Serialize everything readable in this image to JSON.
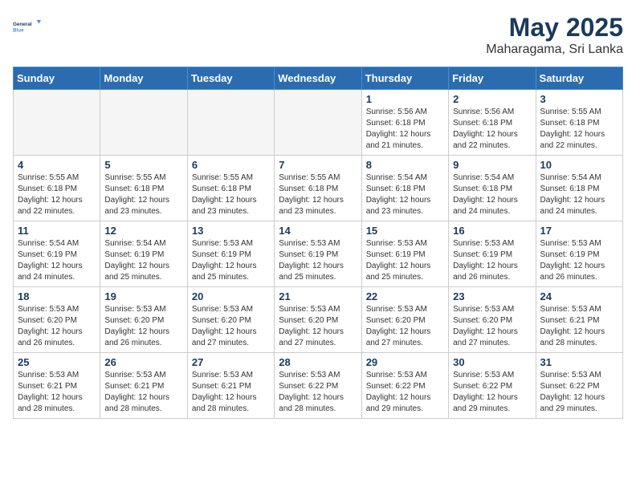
{
  "logo": {
    "name": "General",
    "accent": "Blue"
  },
  "title": "May 2025",
  "subtitle": "Maharagama, Sri Lanka",
  "weekdays": [
    "Sunday",
    "Monday",
    "Tuesday",
    "Wednesday",
    "Thursday",
    "Friday",
    "Saturday"
  ],
  "weeks": [
    [
      {
        "day": "",
        "empty": true
      },
      {
        "day": "",
        "empty": true
      },
      {
        "day": "",
        "empty": true
      },
      {
        "day": "",
        "empty": true
      },
      {
        "day": "1",
        "sunrise": "5:56 AM",
        "sunset": "6:18 PM",
        "daylight": "12 hours and 21 minutes."
      },
      {
        "day": "2",
        "sunrise": "5:56 AM",
        "sunset": "6:18 PM",
        "daylight": "12 hours and 22 minutes."
      },
      {
        "day": "3",
        "sunrise": "5:55 AM",
        "sunset": "6:18 PM",
        "daylight": "12 hours and 22 minutes."
      }
    ],
    [
      {
        "day": "4",
        "sunrise": "5:55 AM",
        "sunset": "6:18 PM",
        "daylight": "12 hours and 22 minutes."
      },
      {
        "day": "5",
        "sunrise": "5:55 AM",
        "sunset": "6:18 PM",
        "daylight": "12 hours and 23 minutes."
      },
      {
        "day": "6",
        "sunrise": "5:55 AM",
        "sunset": "6:18 PM",
        "daylight": "12 hours and 23 minutes."
      },
      {
        "day": "7",
        "sunrise": "5:55 AM",
        "sunset": "6:18 PM",
        "daylight": "12 hours and 23 minutes."
      },
      {
        "day": "8",
        "sunrise": "5:54 AM",
        "sunset": "6:18 PM",
        "daylight": "12 hours and 23 minutes."
      },
      {
        "day": "9",
        "sunrise": "5:54 AM",
        "sunset": "6:18 PM",
        "daylight": "12 hours and 24 minutes."
      },
      {
        "day": "10",
        "sunrise": "5:54 AM",
        "sunset": "6:18 PM",
        "daylight": "12 hours and 24 minutes."
      }
    ],
    [
      {
        "day": "11",
        "sunrise": "5:54 AM",
        "sunset": "6:19 PM",
        "daylight": "12 hours and 24 minutes."
      },
      {
        "day": "12",
        "sunrise": "5:54 AM",
        "sunset": "6:19 PM",
        "daylight": "12 hours and 25 minutes."
      },
      {
        "day": "13",
        "sunrise": "5:53 AM",
        "sunset": "6:19 PM",
        "daylight": "12 hours and 25 minutes."
      },
      {
        "day": "14",
        "sunrise": "5:53 AM",
        "sunset": "6:19 PM",
        "daylight": "12 hours and 25 minutes."
      },
      {
        "day": "15",
        "sunrise": "5:53 AM",
        "sunset": "6:19 PM",
        "daylight": "12 hours and 25 minutes."
      },
      {
        "day": "16",
        "sunrise": "5:53 AM",
        "sunset": "6:19 PM",
        "daylight": "12 hours and 26 minutes."
      },
      {
        "day": "17",
        "sunrise": "5:53 AM",
        "sunset": "6:19 PM",
        "daylight": "12 hours and 26 minutes."
      }
    ],
    [
      {
        "day": "18",
        "sunrise": "5:53 AM",
        "sunset": "6:20 PM",
        "daylight": "12 hours and 26 minutes."
      },
      {
        "day": "19",
        "sunrise": "5:53 AM",
        "sunset": "6:20 PM",
        "daylight": "12 hours and 26 minutes."
      },
      {
        "day": "20",
        "sunrise": "5:53 AM",
        "sunset": "6:20 PM",
        "daylight": "12 hours and 27 minutes."
      },
      {
        "day": "21",
        "sunrise": "5:53 AM",
        "sunset": "6:20 PM",
        "daylight": "12 hours and 27 minutes."
      },
      {
        "day": "22",
        "sunrise": "5:53 AM",
        "sunset": "6:20 PM",
        "daylight": "12 hours and 27 minutes."
      },
      {
        "day": "23",
        "sunrise": "5:53 AM",
        "sunset": "6:20 PM",
        "daylight": "12 hours and 27 minutes."
      },
      {
        "day": "24",
        "sunrise": "5:53 AM",
        "sunset": "6:21 PM",
        "daylight": "12 hours and 28 minutes."
      }
    ],
    [
      {
        "day": "25",
        "sunrise": "5:53 AM",
        "sunset": "6:21 PM",
        "daylight": "12 hours and 28 minutes."
      },
      {
        "day": "26",
        "sunrise": "5:53 AM",
        "sunset": "6:21 PM",
        "daylight": "12 hours and 28 minutes."
      },
      {
        "day": "27",
        "sunrise": "5:53 AM",
        "sunset": "6:21 PM",
        "daylight": "12 hours and 28 minutes."
      },
      {
        "day": "28",
        "sunrise": "5:53 AM",
        "sunset": "6:22 PM",
        "daylight": "12 hours and 28 minutes."
      },
      {
        "day": "29",
        "sunrise": "5:53 AM",
        "sunset": "6:22 PM",
        "daylight": "12 hours and 29 minutes."
      },
      {
        "day": "30",
        "sunrise": "5:53 AM",
        "sunset": "6:22 PM",
        "daylight": "12 hours and 29 minutes."
      },
      {
        "day": "31",
        "sunrise": "5:53 AM",
        "sunset": "6:22 PM",
        "daylight": "12 hours and 29 minutes."
      }
    ]
  ]
}
